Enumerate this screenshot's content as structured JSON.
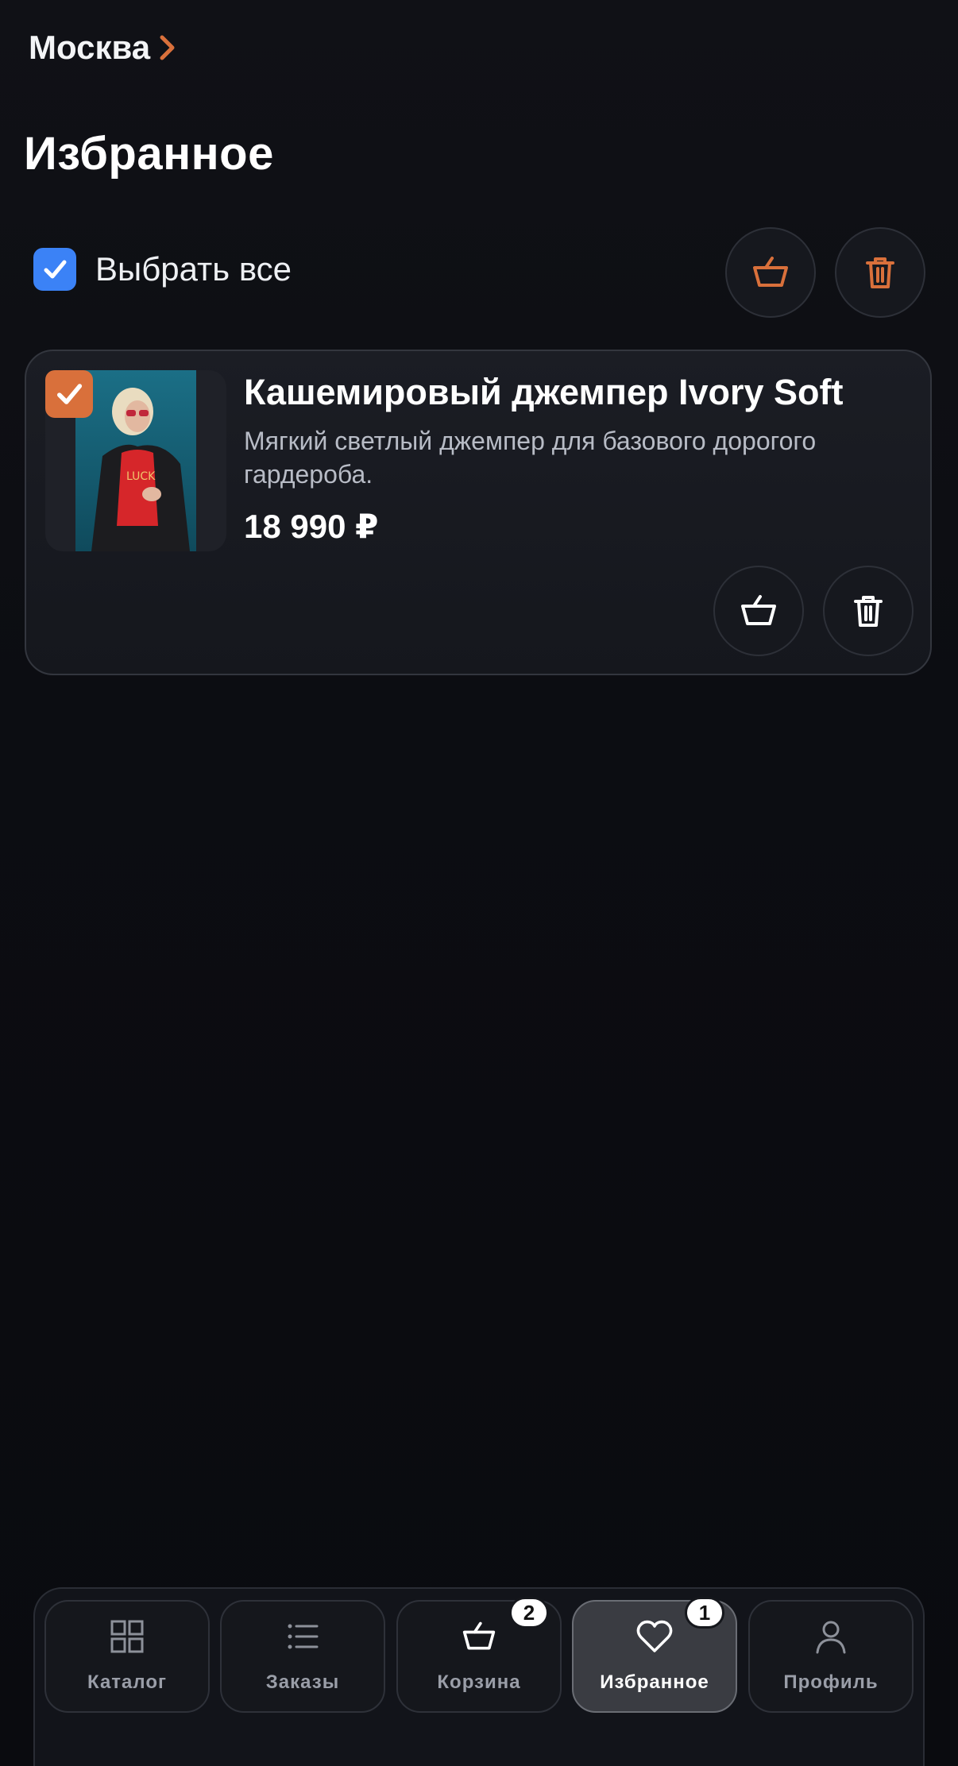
{
  "header": {
    "city": "Москва",
    "title": "Избранное"
  },
  "toolbar": {
    "select_all_label": "Выбрать все",
    "select_all_checked": true
  },
  "items": [
    {
      "title": "Кашемировый джемпер Ivory Soft",
      "description": "Мягкий светлый джемпер для базового дорогого гардероба.",
      "price": "18 990 ₽",
      "selected": true
    }
  ],
  "nav": {
    "items": [
      {
        "label": "Каталог",
        "icon": "grid-icon",
        "active": false
      },
      {
        "label": "Заказы",
        "icon": "list-icon",
        "active": false
      },
      {
        "label": "Корзина",
        "icon": "basket-icon",
        "badge": "2",
        "active": false
      },
      {
        "label": "Избранное",
        "icon": "heart-icon",
        "badge": "1",
        "active": true
      },
      {
        "label": "Профиль",
        "icon": "user-icon",
        "active": false
      }
    ]
  },
  "colors": {
    "accent": "#d9703b",
    "checkbox_blue": "#3b82f6",
    "background": "#0b0c10"
  }
}
